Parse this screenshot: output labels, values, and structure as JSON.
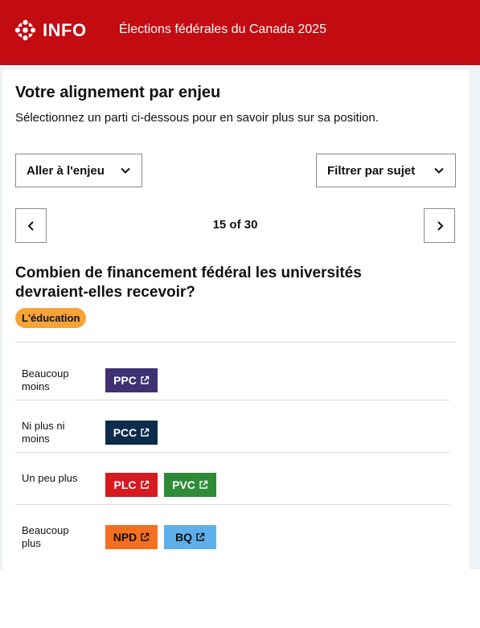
{
  "header": {
    "logo_text": "INFO",
    "title": "Élections fédérales du Canada 2025",
    "bg_color": "#c30b12"
  },
  "intro": {
    "heading": "Votre alignement par enjeu",
    "subheading": "Sélectionnez un parti ci-dessous pour en savoir plus sur sa position."
  },
  "controls": {
    "goto_issue_label": "Aller à l'enjeu",
    "filter_label": "Filtrer par sujet",
    "pager_text": "15 of 30",
    "prev_icon": "chevron-left-icon",
    "next_icon": "chevron-right-icon"
  },
  "question": {
    "text": "Combien de financement fédéral les universités devraient-elles recevoir?",
    "tag": "L'éducation",
    "tag_color": "#f6a33a"
  },
  "rows": [
    {
      "label": "Beaucoup moins",
      "parties": [
        {
          "name": "PPC",
          "bg": "#3f3174",
          "fg": "#ffffff"
        }
      ]
    },
    {
      "label": "Ni plus ni moins",
      "parties": [
        {
          "name": "PCC",
          "bg": "#0d2b4a",
          "fg": "#ffffff"
        }
      ]
    },
    {
      "label": "Un peu plus",
      "parties": [
        {
          "name": "PLC",
          "bg": "#d71920",
          "fg": "#ffffff"
        },
        {
          "name": "PVC",
          "bg": "#2e8b38",
          "fg": "#ffffff"
        }
      ]
    },
    {
      "label": "Beaucoup plus",
      "parties": [
        {
          "name": "NPD",
          "bg": "#f37021",
          "fg": "#111111"
        },
        {
          "name": "BQ",
          "bg": "#5fb0ea",
          "fg": "#111111"
        }
      ]
    }
  ]
}
